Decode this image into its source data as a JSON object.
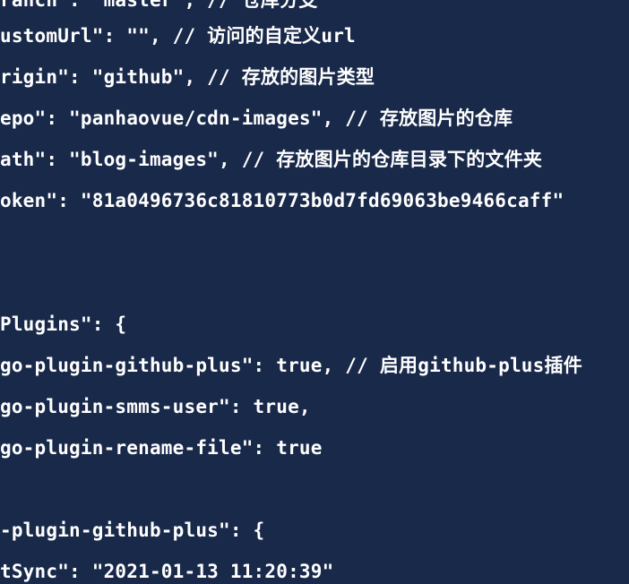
{
  "code_lines": [
    "ranch\": \"master\", // 仓库分支",
    "ustomUrl\": \"\", // 访问的自定义url",
    "rigin\": \"github\", // 存放的图片类型",
    "epo\": \"panhaovue/cdn-images\", // 存放图片的仓库",
    "ath\": \"blog-images\", // 存放图片的仓库目录下的文件夹",
    "oken\": \"81a0496736c81810773b0d7fd69063be9466caff\"",
    "",
    "",
    "Plugins\": {",
    "go-plugin-github-plus\": true, // 启用github-plus插件",
    "go-plugin-smms-user\": true,",
    "go-plugin-rename-file\": true",
    "",
    "-plugin-github-plus\": {",
    "tSync\": \"2021-01-13 11:20:39\""
  ]
}
